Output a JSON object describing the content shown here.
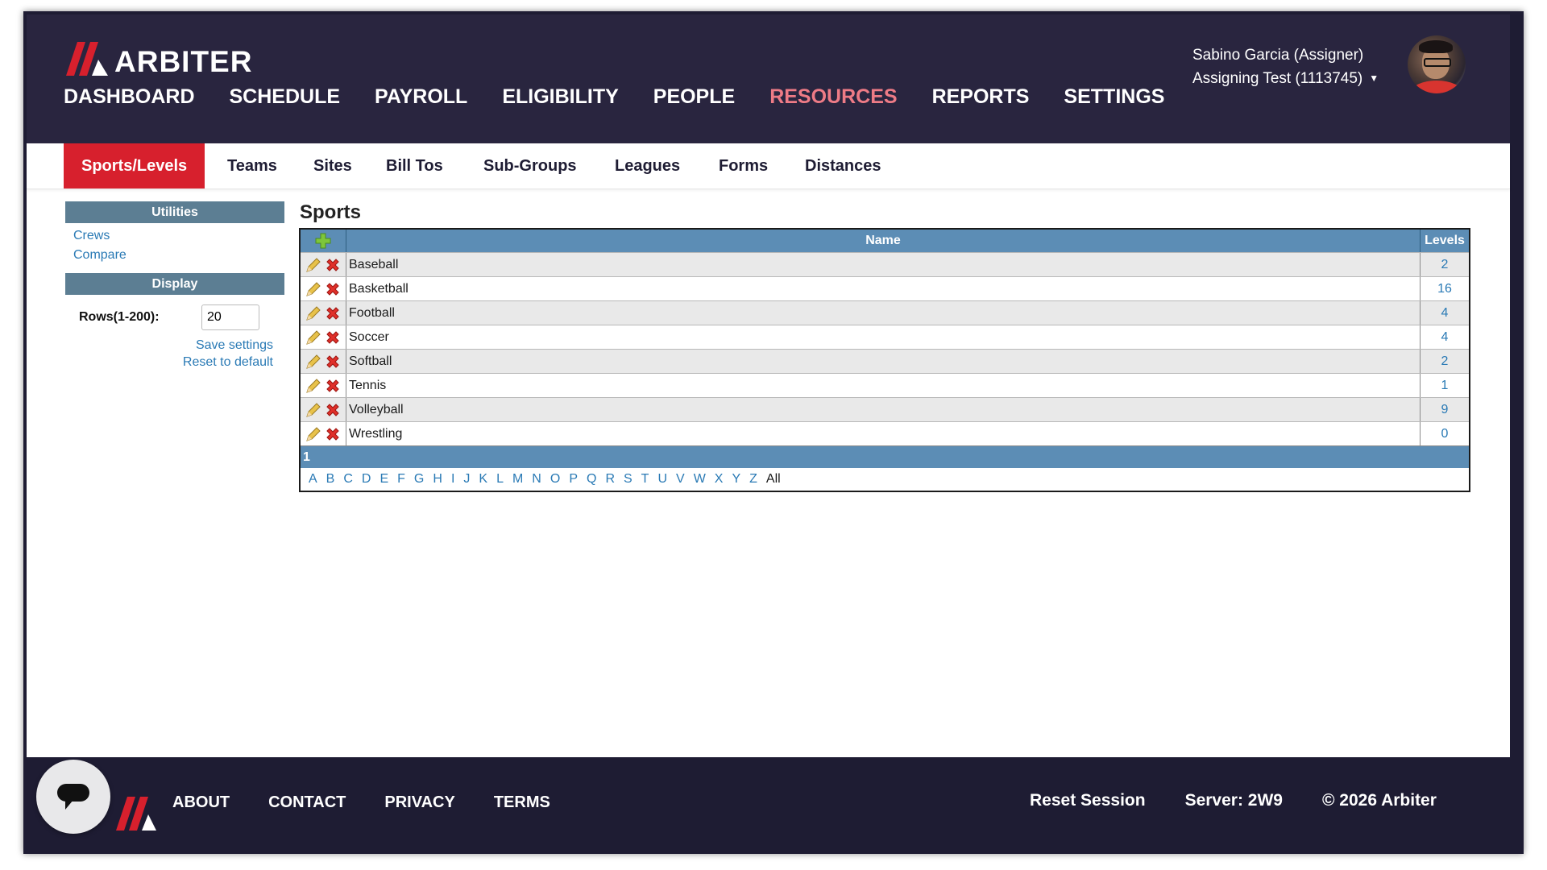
{
  "app": {
    "brand": "ARBITER"
  },
  "main_nav": [
    {
      "label": "DASHBOARD"
    },
    {
      "label": "SCHEDULE"
    },
    {
      "label": "PAYROLL"
    },
    {
      "label": "ELIGIBILITY"
    },
    {
      "label": "PEOPLE"
    },
    {
      "label": "RESOURCES",
      "active": true
    },
    {
      "label": "REPORTS"
    },
    {
      "label": "SETTINGS"
    }
  ],
  "user": {
    "name": "Sabino Garcia (Assigner)",
    "account": "Assigning Test (1113745)"
  },
  "sub_nav": [
    {
      "label": "Sports/Levels",
      "active": true
    },
    {
      "label": "Teams"
    },
    {
      "label": "Sites"
    },
    {
      "label": "Bill Tos"
    },
    {
      "label": "Sub-Groups"
    },
    {
      "label": "Leagues"
    },
    {
      "label": "Forms"
    },
    {
      "label": "Distances"
    }
  ],
  "utilities": {
    "title": "Utilities",
    "links": [
      "Crews",
      "Compare"
    ]
  },
  "display": {
    "title": "Display",
    "rows_label": "Rows(1-200):",
    "rows_value": "20",
    "save_label": "Save settings",
    "reset_label": "Reset to default"
  },
  "sports": {
    "title": "Sports",
    "columns": {
      "name": "Name",
      "levels": "Levels"
    },
    "rows": [
      {
        "name": "Baseball",
        "levels": "2"
      },
      {
        "name": "Basketball",
        "levels": "16"
      },
      {
        "name": "Football",
        "levels": "4"
      },
      {
        "name": "Soccer",
        "levels": "4"
      },
      {
        "name": "Softball",
        "levels": "2"
      },
      {
        "name": "Tennis",
        "levels": "1"
      },
      {
        "name": "Volleyball",
        "levels": "9"
      },
      {
        "name": "Wrestling",
        "levels": "0"
      }
    ],
    "page": "1",
    "alphabet": [
      "A",
      "B",
      "C",
      "D",
      "E",
      "F",
      "G",
      "H",
      "I",
      "J",
      "K",
      "L",
      "M",
      "N",
      "O",
      "P",
      "Q",
      "R",
      "S",
      "T",
      "U",
      "V",
      "W",
      "X",
      "Y",
      "Z"
    ],
    "alphabet_all": "All"
  },
  "footer": {
    "links": [
      "ABOUT",
      "CONTACT",
      "PRIVACY",
      "TERMS"
    ],
    "reset_session": "Reset Session",
    "server": "Server: 2W9",
    "copyright": "© 2026 Arbiter"
  },
  "colors": {
    "header_bg": "#29253f",
    "brand_red": "#d7202d",
    "active_nav": "#ee7b86",
    "table_header": "#5c8db5",
    "panel_header": "#5c7e93",
    "link_blue": "#2a7ab5"
  }
}
